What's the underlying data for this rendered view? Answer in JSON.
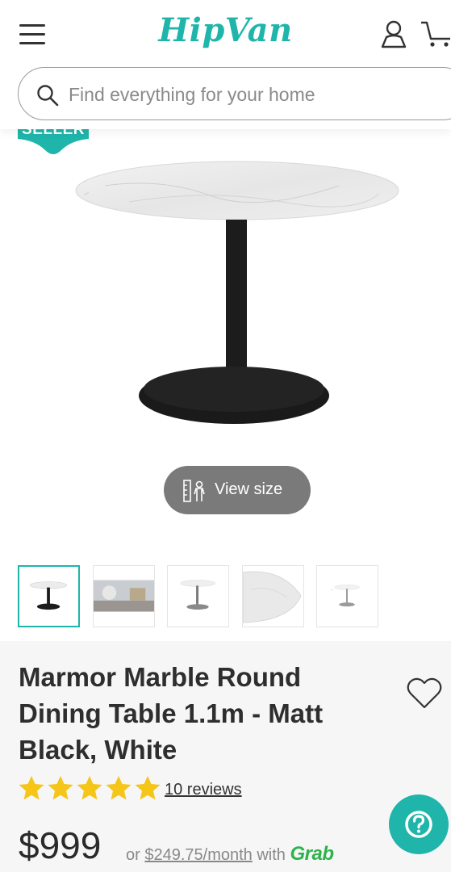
{
  "header": {
    "logo_text": "HipVan",
    "search_placeholder": "Find everything for your home"
  },
  "badge": {
    "text": "SELLER"
  },
  "gallery": {
    "view_size_label": "View size",
    "thumbnail_count": 5,
    "active_index": 0
  },
  "product": {
    "title": "Marmor Marble Round Dining Table 1.1m - Matt Black, White",
    "rating": 5,
    "reviews_label": "10 reviews",
    "price": "$999",
    "installment_prefix": "or",
    "installment_amount": "$249.75/month",
    "installment_with": "with",
    "installment_provider": "Grab"
  },
  "colors": {
    "brand": "#1fb5aa",
    "star": "#f5c518",
    "grab": "#2cb34a"
  },
  "icons": [
    "menu-icon",
    "user-icon",
    "cart-icon",
    "search-icon",
    "ruler-person-icon",
    "heart-icon",
    "star-icon",
    "help-icon"
  ]
}
